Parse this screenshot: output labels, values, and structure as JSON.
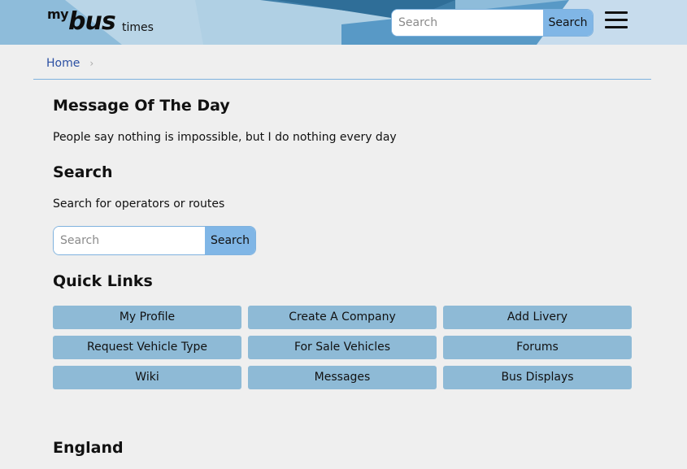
{
  "header": {
    "logo": {
      "my": "my",
      "bus": "bus",
      "times": "times"
    },
    "search": {
      "placeholder": "Search",
      "button_label": "Search"
    },
    "colors": {
      "bg": "#8ebcda",
      "accent": "#80b6e6"
    }
  },
  "breadcrumb": {
    "home": "Home",
    "separator": "›"
  },
  "motd": {
    "title": "Message Of The Day",
    "text": "People say nothing is impossible, but I do nothing every day"
  },
  "search_section": {
    "title": "Search",
    "description": "Search for operators or routes",
    "placeholder": "Search",
    "button_label": "Search"
  },
  "quick_links": {
    "title": "Quick Links",
    "items": [
      {
        "label": "My Profile"
      },
      {
        "label": "Create A Company"
      },
      {
        "label": "Add Livery"
      },
      {
        "label": "Request Vehicle Type"
      },
      {
        "label": "For Sale Vehicles"
      },
      {
        "label": "Forums"
      },
      {
        "label": "Wiki"
      },
      {
        "label": "Messages"
      },
      {
        "label": "Bus Displays"
      }
    ]
  },
  "region": {
    "title": "England"
  }
}
